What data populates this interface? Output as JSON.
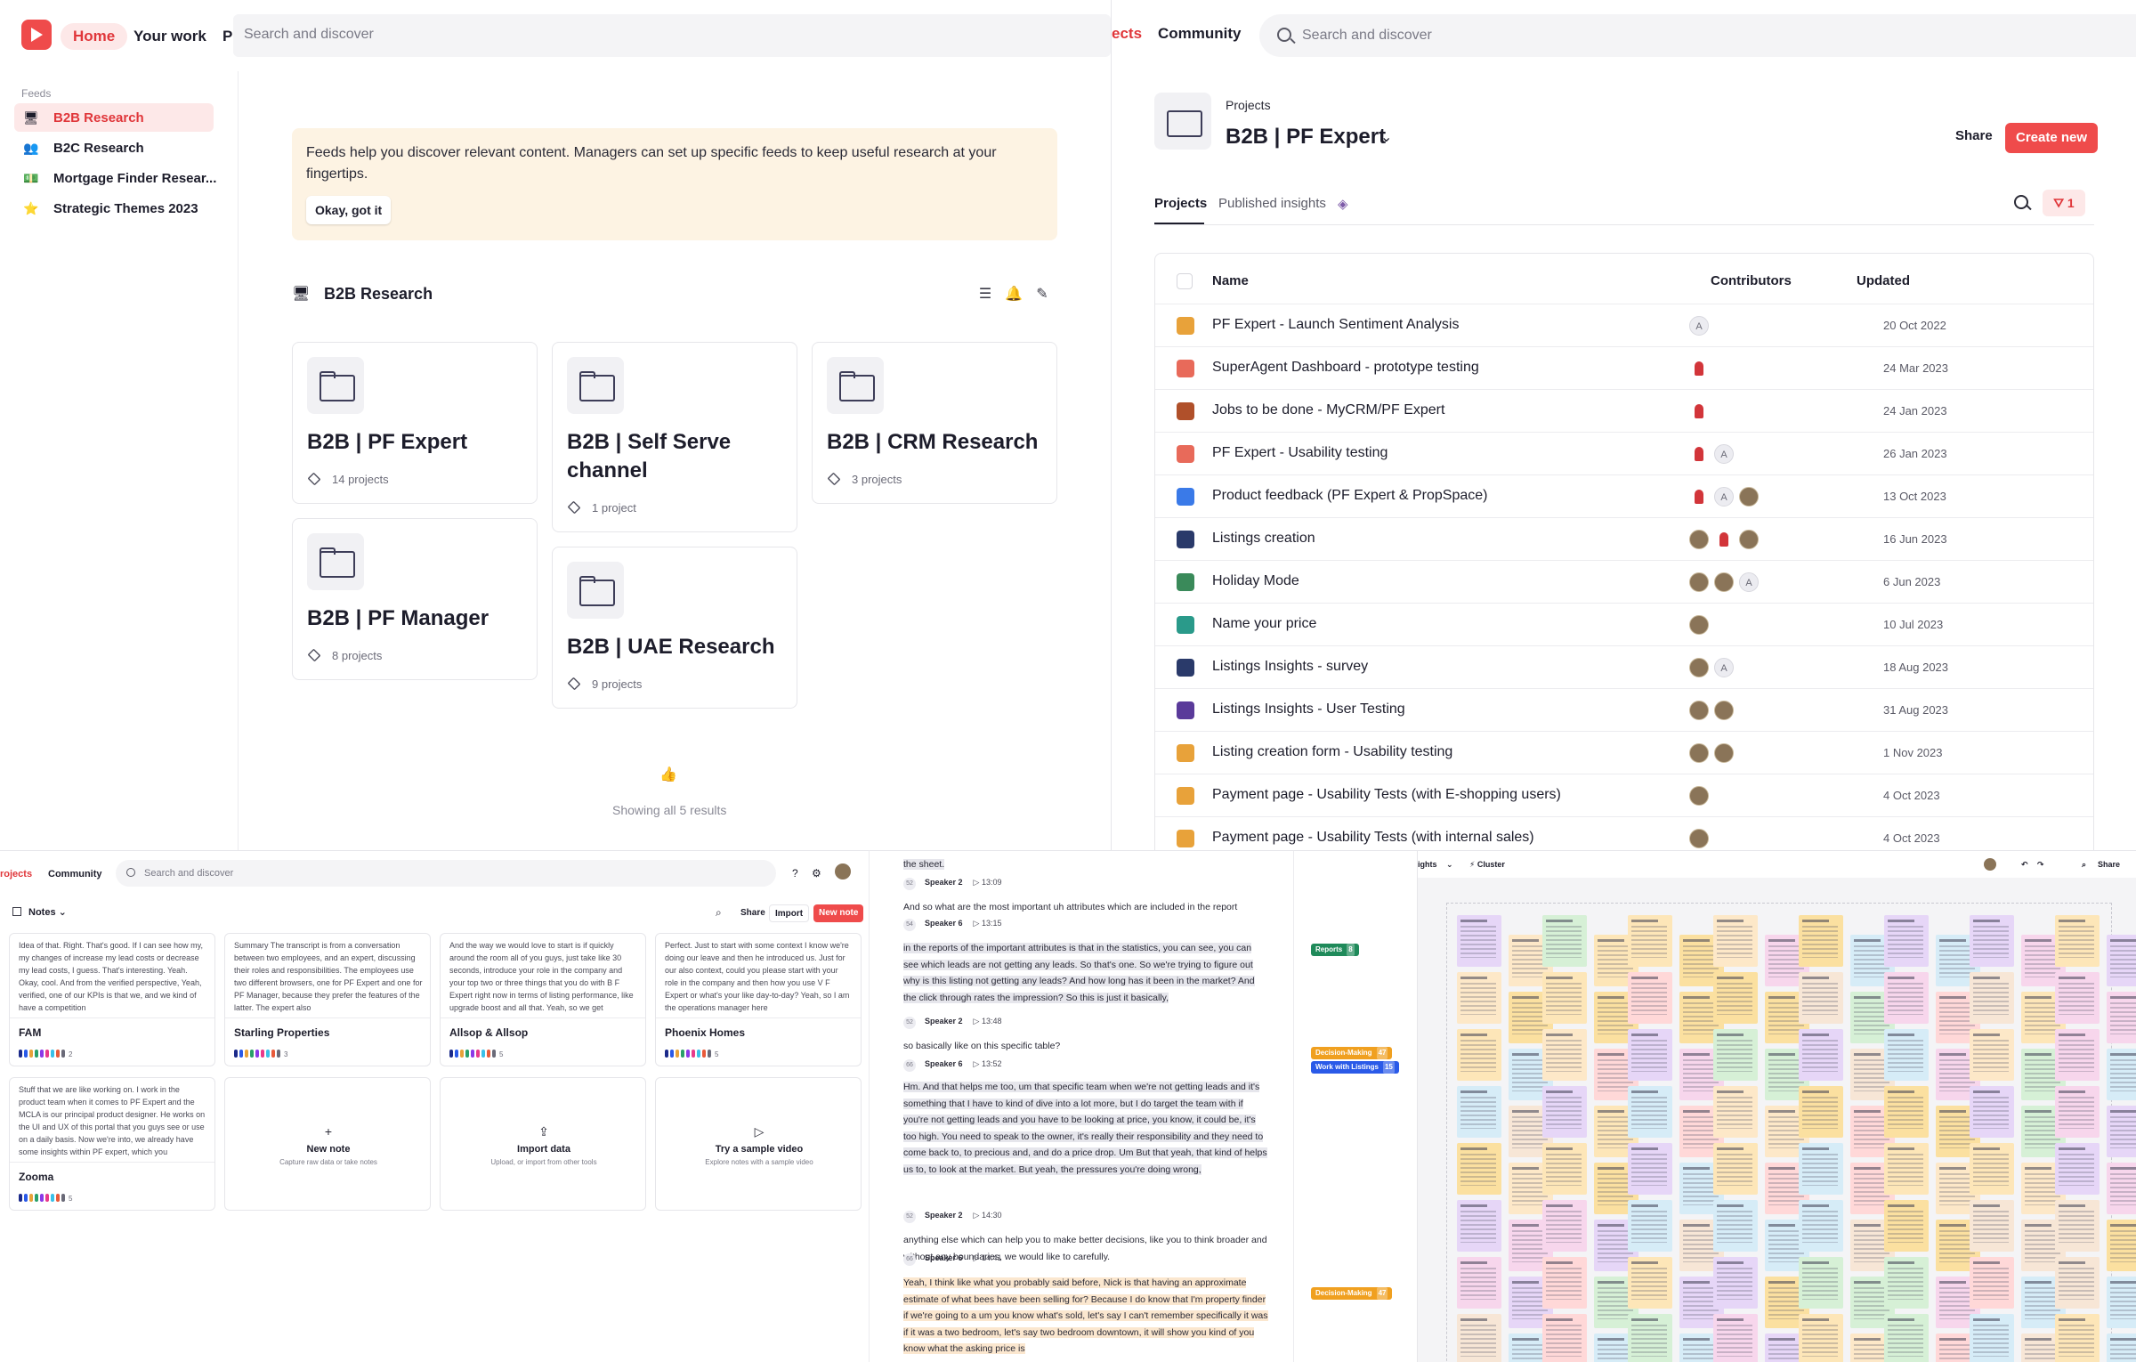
{
  "panel1": {
    "nav": {
      "home": "Home",
      "your_work": "Your work",
      "projects_fragment": "Pr"
    },
    "search_placeholder": "Search and discover",
    "feeds_label": "Feeds",
    "feeds": [
      {
        "label": "B2B Research",
        "icon": "monitor-icon",
        "active": true
      },
      {
        "label": "B2C Research",
        "icon": "people-icon",
        "active": false
      },
      {
        "label": "Mortgage Finder Resear...",
        "icon": "money-icon",
        "active": false
      },
      {
        "label": "Strategic Themes 2023",
        "icon": "star-icon",
        "active": false
      }
    ],
    "banner": {
      "text": "Feeds help you discover relevant content. Managers can set up specific feeds to keep useful research at your fingertips.",
      "button": "Okay, got it"
    },
    "section_title": "B2B Research",
    "cards": [
      {
        "title": "B2B | PF Expert",
        "meta": "14 projects"
      },
      {
        "title": "B2B | Self Serve channel",
        "meta": "1 project"
      },
      {
        "title": "B2B | CRM Research",
        "meta": "3 projects"
      },
      {
        "title": "B2B | PF Manager",
        "meta": "8 projects"
      },
      {
        "title": "B2B | UAE Research",
        "meta": "9 projects"
      }
    ],
    "footer": "Showing all 5 results"
  },
  "panel2": {
    "nav_fragment": "ects",
    "community": "Community",
    "search_placeholder": "Search and discover",
    "breadcrumb": "Projects",
    "title": "B2B | PF Expert",
    "share": "Share",
    "create": "Create new",
    "tabs": [
      "Projects",
      "Published insights"
    ],
    "filter_count": "1",
    "columns": [
      "Name",
      "Contributors",
      "Updated"
    ],
    "rows": [
      {
        "name": "PF Expert - Launch Sentiment Analysis",
        "date": "20 Oct 2022",
        "icon_color": "#e8a23a",
        "avatars": [
          "A"
        ]
      },
      {
        "name": "SuperAgent Dashboard - prototype testing",
        "date": "24 Mar 2023",
        "icon_color": "#e86a5a",
        "avatars": [
          "red"
        ]
      },
      {
        "name": "Jobs to be done - MyCRM/PF Expert",
        "date": "24 Jan 2023",
        "icon_color": "#b0502a",
        "avatars": [
          "red"
        ]
      },
      {
        "name": "PF Expert - Usability testing",
        "date": "26 Jan 2023",
        "icon_color": "#e86a5a",
        "avatars": [
          "red",
          "A"
        ]
      },
      {
        "name": "Product feedback (PF Expert & PropSpace)",
        "date": "13 Oct 2023",
        "icon_color": "#3a7ae8",
        "avatars": [
          "red",
          "A",
          "photo"
        ]
      },
      {
        "name": "Listings creation",
        "date": "16 Jun 2023",
        "icon_color": "#2a3a6a",
        "avatars": [
          "photo",
          "red",
          "photo"
        ]
      },
      {
        "name": "Holiday Mode",
        "date": "6 Jun 2023",
        "icon_color": "#3a8a5a",
        "avatars": [
          "photo",
          "photo",
          "A"
        ]
      },
      {
        "name": "Name your price",
        "date": "10 Jul 2023",
        "icon_color": "#2a9a8a",
        "avatars": [
          "photo"
        ]
      },
      {
        "name": "Listings Insights - survey",
        "date": "18 Aug 2023",
        "icon_color": "#2a3a6a",
        "avatars": [
          "photo",
          "A"
        ]
      },
      {
        "name": "Listings Insights - User Testing",
        "date": "31 Aug 2023",
        "icon_color": "#5a3a9a",
        "avatars": [
          "photo",
          "photo"
        ]
      },
      {
        "name": "Listing creation form - Usability testing",
        "date": "1 Nov 2023",
        "icon_color": "#e8a23a",
        "avatars": [
          "photo",
          "photo"
        ]
      },
      {
        "name": "Payment page - Usability Tests (with E-shopping users)",
        "date": "4 Oct 2023",
        "icon_color": "#e8a23a",
        "avatars": [
          "photo"
        ]
      },
      {
        "name": "Payment page - Usability Tests (with internal sales)",
        "date": "4 Oct 2023",
        "icon_color": "#e8a23a",
        "avatars": [
          "photo"
        ]
      }
    ]
  },
  "panel3": {
    "nav_fragment": "rojects",
    "community": "Community",
    "search_placeholder": "Search and discover",
    "view": "Notes",
    "share": "Share",
    "import": "Import",
    "new_note": "New note",
    "notes": [
      {
        "name": "FAM",
        "count": "2",
        "text": "Idea of that. Right. That's good. If I can see how my, my changes of increase my lead costs or decrease my lead costs, I guess. That's interesting. Yeah. Okay, cool. And from the verified perspective, Yeah, verified, one of our KPIs is that we, and we kind of have a competition"
      },
      {
        "name": "Starling Properties",
        "count": "3",
        "text": "Summary The transcript is from a conversation between two employees, and an expert, discussing their roles and responsibilities. The employees use two different browsers, one for PF Expert and one for PF Manager, because they prefer the features of the latter. The expert also"
      },
      {
        "name": "Allsop & Allsop",
        "count": "5",
        "text": "And the way we would love to start is if quickly around the room all of you guys, just take like 30 seconds, introduce your role in the company and your top two or three things that you do with B F Expert right now in terms of listing performance, like upgrade boost and all that. Yeah, so we get"
      },
      {
        "name": "Phoenix Homes",
        "count": "5",
        "text": "Perfect. Just to start with some context I know we're doing our leave and then he introduced us. Just for our also context, could you please start with your role in the company and then how you use V F Expert or what's your like day-to-day? Yeah, so I am the operations manager here"
      },
      {
        "name": "Zooma",
        "count": "5",
        "text": "Stuff that we are like working on. I work in the product team when it comes to PF Expert and the MCLA is our principal product designer. He works on the UI and UX of this portal that you guys see or use on a daily basis. Now we're into, we already have some insights within PF expert, which you"
      }
    ],
    "actions": [
      {
        "title": "New note",
        "subtitle": "Capture raw data or take notes",
        "icon": "plus-icon"
      },
      {
        "title": "Import data",
        "subtitle": "Upload, or import from other tools",
        "icon": "upload-icon"
      },
      {
        "title": "Try a sample video",
        "subtitle": "Explore notes with a sample video",
        "icon": "play-icon"
      }
    ],
    "dot_colors": [
      "#1b2a8a",
      "#2a5ae8",
      "#e8a23a",
      "#2aa06a",
      "#8a3ae8",
      "#e83a8a",
      "#3ac0e8",
      "#e85a3a",
      "#6a6a78"
    ]
  },
  "panel4": {
    "blocks": [
      {
        "type": "text",
        "text": "the sheet.",
        "hl": "grey"
      },
      {
        "type": "speaker",
        "num": "52",
        "name": "Speaker 2",
        "time": "13:09"
      },
      {
        "type": "text",
        "text": "And so what are the most important uh attributes which are included in the report",
        "hl": ""
      },
      {
        "type": "speaker",
        "num": "54",
        "name": "Speaker 6",
        "time": "13:15"
      },
      {
        "type": "text",
        "text": "in the reports of the important attributes is that in the statistics, you can see, you can see which leads are not getting any leads. So that's one. So we're trying to figure out why is this listing not getting any leads? And how long has it been in the market? And the click through rates the impression? So this is just it basically,",
        "hl": "grey"
      },
      {
        "type": "speaker",
        "num": "52",
        "name": "Speaker 2",
        "time": "13:48"
      },
      {
        "type": "text",
        "text": "so basically like on this specific table?",
        "hl": ""
      },
      {
        "type": "speaker",
        "num": "66",
        "name": "Speaker 6",
        "time": "13:52"
      },
      {
        "type": "text",
        "text": "Hm. And that helps me too, um that specific team when we're not getting leads and it's something that I have to kind of dive into a lot more, but I do target the team with if you're not getting leads and you have to be looking at price, you know, it could be, it's too high. You need to speak to the owner, it's really their responsibility and they need to come back to, to precious and, and do a price drop. Um But that yeah, that kind of helps us to, to look at the market. But yeah, the pressures you're doing wrong,",
        "hl": "grey"
      },
      {
        "type": "speaker",
        "num": "52",
        "name": "Speaker 2",
        "time": "14:30"
      },
      {
        "type": "text",
        "text": "anything else which can help you to make better decisions, like you to think broader and without any boundaries, we would like to carefully.",
        "hl": ""
      },
      {
        "type": "speaker",
        "num": "66",
        "name": "Speaker 6",
        "time": "14:41"
      },
      {
        "type": "text",
        "text": "Yeah, I think like what you probably said before, Nick is that having an approximate estimate of what bees have been selling for? Because I do know that I'm property finder if we're going to a um you know what's sold, let's say I can't remember specifically it was if it was a two bedroom, let's say two bedroom downtown, it will show you kind of you know what the asking price is",
        "hl": "orange"
      }
    ],
    "tags": [
      {
        "label": "Reports",
        "count": "8",
        "color": "#1f8a5a"
      },
      {
        "label": "Decision-Making",
        "count": "47",
        "color": "#f0a020"
      },
      {
        "label": "Work with Listings",
        "count": "15",
        "color": "#2a5ae8"
      },
      {
        "label": "Decision-Making",
        "count": "47",
        "color": "#f0a020"
      }
    ]
  },
  "panel5": {
    "toolbar": {
      "insights_fragment": "ights",
      "cluster": "Cluster",
      "share": "Share"
    },
    "sticky_palette": [
      "#f7d6ec",
      "#fde6b8",
      "#d6ecf7",
      "#fbe0a0",
      "#e6d6f7",
      "#fde8c8",
      "#d6f0d6",
      "#f7e6d6",
      "#ffd8d8"
    ]
  }
}
